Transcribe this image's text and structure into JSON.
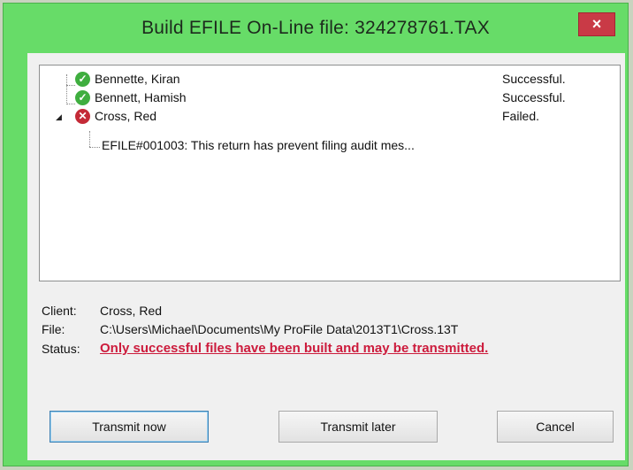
{
  "window": {
    "title": "Build EFILE On-Line file: 324278761.TAX",
    "close_glyph": "×"
  },
  "tree": {
    "items": [
      {
        "name": "Bennette, Kiran",
        "status": "Successful.",
        "icon": "check-circle-icon"
      },
      {
        "name": "Bennett, Hamish",
        "status": "Successful.",
        "icon": "check-circle-icon"
      },
      {
        "name": "Cross, Red",
        "status": "Failed.",
        "icon": "error-circle-icon"
      }
    ],
    "child_message": "EFILE#001003: This return has prevent filing audit mes...",
    "expander_glyph": "◢"
  },
  "details": {
    "client_label": "Client:",
    "client_value": "Cross, Red",
    "file_label": "File:",
    "file_value": "C:\\Users\\Michael\\Documents\\My ProFile Data\\2013T1\\Cross.13T",
    "status_label": "Status:",
    "status_value": "Only successful files have been built and may be transmitted."
  },
  "buttons": {
    "transmit_now": "Transmit now",
    "transmit_later": "Transmit later",
    "cancel": "Cancel"
  },
  "colors": {
    "title_bar": "#67dc68",
    "close_button": "#c93a46",
    "status_text": "#cc1b3c",
    "success_icon": "#3fae3f",
    "fail_icon": "#c42a37"
  }
}
